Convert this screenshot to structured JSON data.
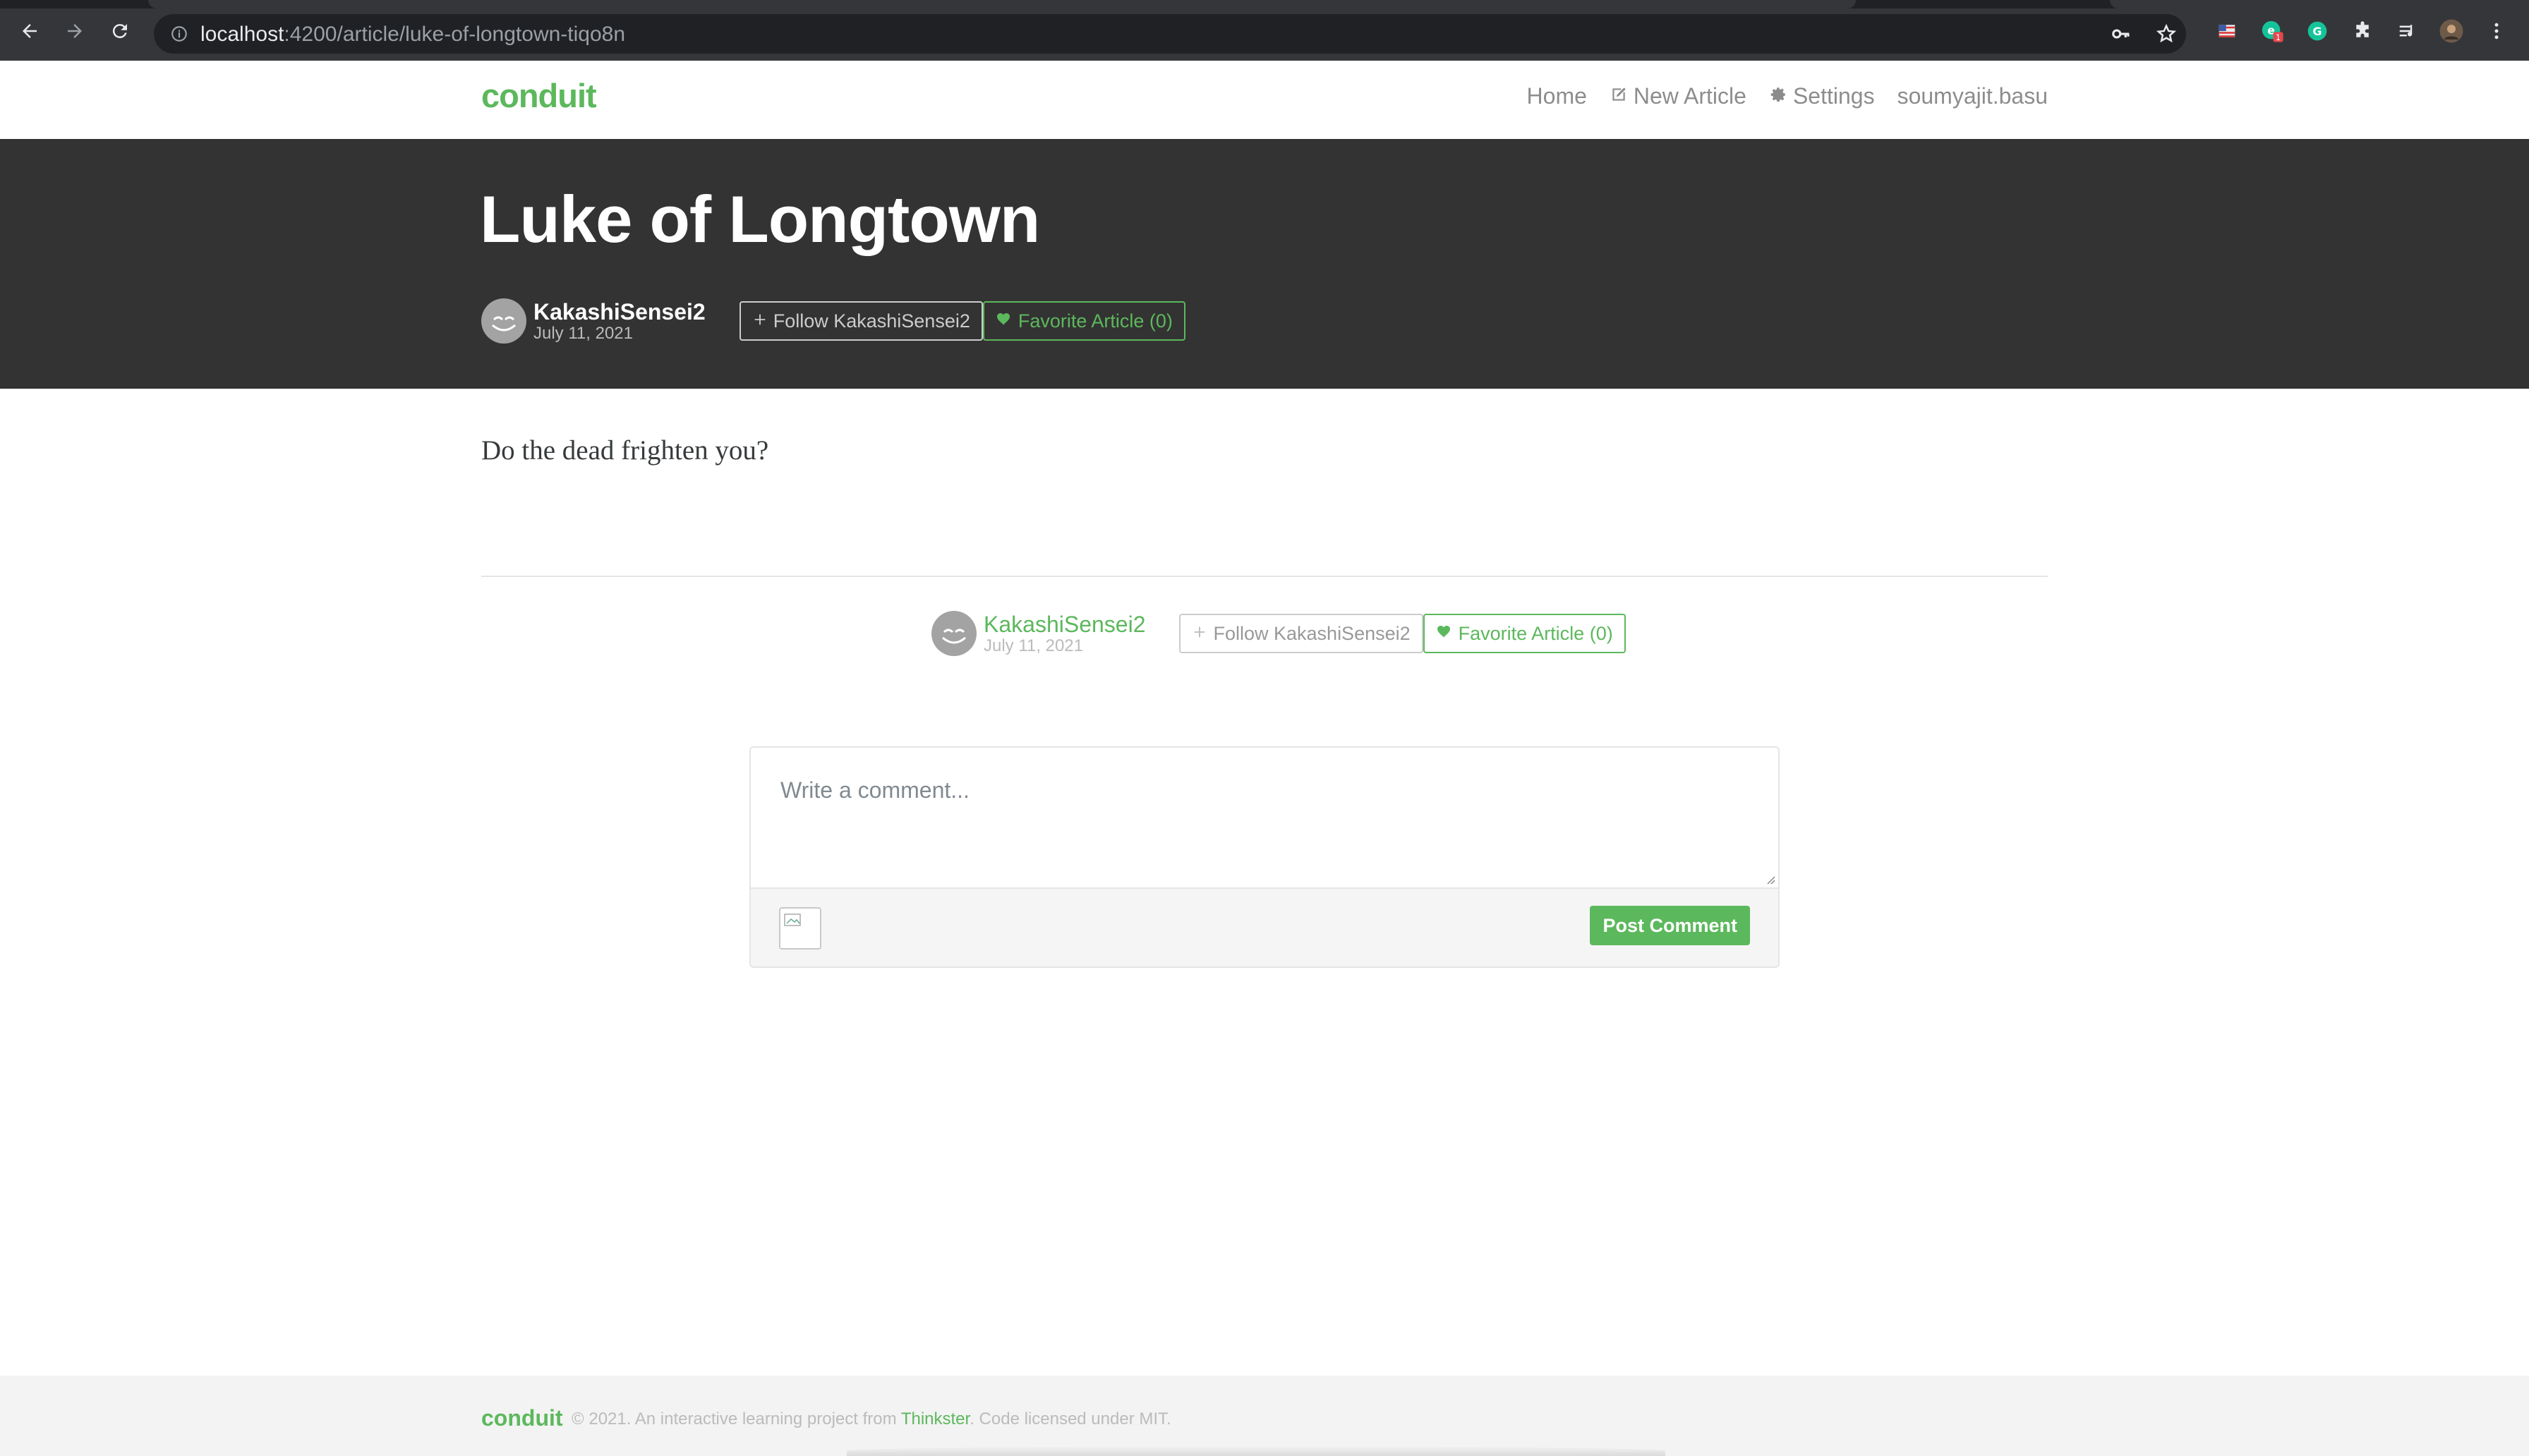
{
  "browser": {
    "url_host": "localhost",
    "url_path": ":4200/article/luke-of-longtown-tiqo8n",
    "extension_badge": "1",
    "icons": [
      "back-icon",
      "forward-icon",
      "reload-icon",
      "info-icon",
      "key-icon",
      "star-icon",
      "flag-extension-icon",
      "grammarly-extension-icon",
      "green-extension-icon",
      "puzzle-icon",
      "media-icon",
      "profile-avatar",
      "kebab-menu-icon"
    ]
  },
  "nav": {
    "brand": "conduit",
    "links": {
      "home": "Home",
      "new_article": "New Article",
      "settings": "Settings",
      "profile": "soumyajit.basu"
    }
  },
  "article": {
    "title": "Luke of Longtown",
    "body": "Do the dead frighten you?",
    "author": "KakashiSensei2",
    "date": "July 11, 2021",
    "follow_label": "Follow KakashiSensei2",
    "favorite_label": "Favorite Article (0)"
  },
  "comment": {
    "placeholder": "Write a comment...",
    "post_label": "Post Comment"
  },
  "footer": {
    "logo": "conduit",
    "text_before": "© 2021. An interactive learning project from ",
    "link": "Thinkster",
    "text_after": ". Code licensed under MIT."
  },
  "colors": {
    "accent": "#5cb85c",
    "banner": "#333333",
    "footer_bg": "#f3f3f3"
  }
}
